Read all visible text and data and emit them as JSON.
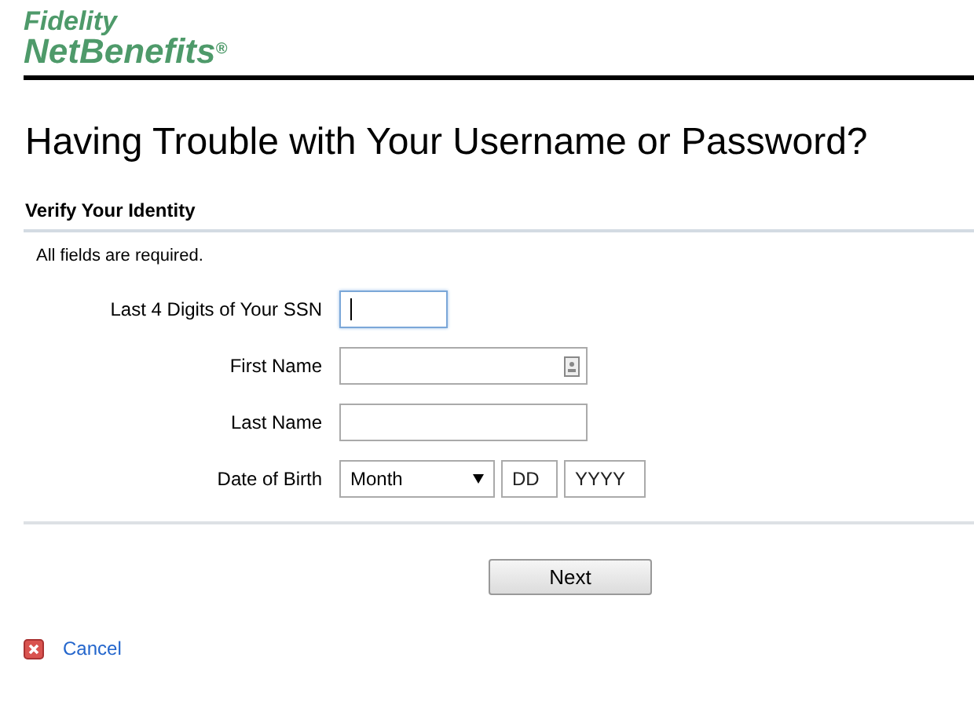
{
  "logo": {
    "line_1": "Fidelity",
    "line_2": "NetBenefits",
    "mark": "®"
  },
  "title": "Having Trouble with Your Username or Password?",
  "section": {
    "heading": "Verify Your Identity",
    "note": "All fields are required."
  },
  "fields": [
    {
      "kind": "text",
      "label": "Last 4 Digits of Your SSN",
      "focused": true
    },
    {
      "kind": "contact",
      "label": "First Name",
      "focused": false
    },
    {
      "kind": "text",
      "label": "Last Name",
      "focused": false
    },
    {
      "kind": "date",
      "label": "Date of Birth",
      "focused": false,
      "month": "Month",
      "day_placeholder": "DD",
      "year_placeholder": "YYYY"
    }
  ],
  "next_button": "Next",
  "cancel_link": "Cancel"
}
